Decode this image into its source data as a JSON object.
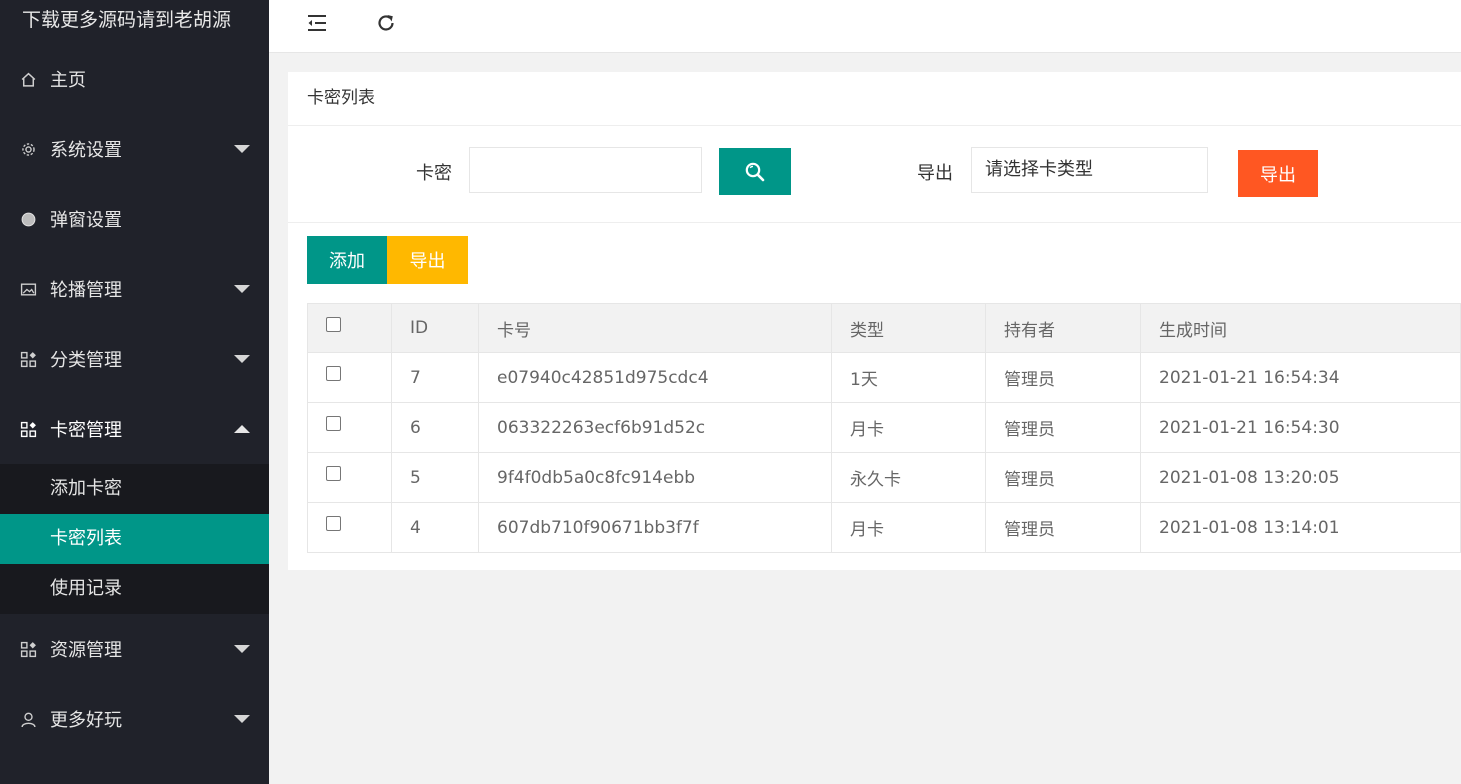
{
  "sidebar": {
    "logo": "下载更多源码请到老胡源",
    "items": [
      {
        "label": "主页"
      },
      {
        "label": "系统设置"
      },
      {
        "label": "弹窗设置"
      },
      {
        "label": "轮播管理"
      },
      {
        "label": "分类管理"
      },
      {
        "label": "卡密管理"
      },
      {
        "label": "资源管理"
      },
      {
        "label": "更多好玩"
      }
    ],
    "sub_items": [
      {
        "label": "添加卡密"
      },
      {
        "label": "卡密列表"
      },
      {
        "label": "使用记录"
      }
    ]
  },
  "header": {
    "menu_toggle_icon": "indent-icon",
    "refresh_icon": "refresh-icon"
  },
  "card": {
    "title": "卡密列表",
    "search": {
      "label": "卡密",
      "value": "",
      "button_icon": "search-icon"
    },
    "export": {
      "label": "导出",
      "select_value": "请选择卡类型",
      "button_label": "导出"
    },
    "toolbar": {
      "add_label": "添加",
      "export_label": "导出"
    },
    "table": {
      "headers": [
        "ID",
        "卡号",
        "类型",
        "持有者",
        "生成时间"
      ],
      "rows": [
        {
          "id": "7",
          "card_no": "e07940c42851d975cdc4",
          "type": "1天",
          "owner": "管理员",
          "created": "2021-01-21 16:54:34"
        },
        {
          "id": "6",
          "card_no": "063322263ecf6b91d52c",
          "type": "月卡",
          "owner": "管理员",
          "created": "2021-01-21 16:54:30"
        },
        {
          "id": "5",
          "card_no": "9f4f0db5a0c8fc914ebb",
          "type": "永久卡",
          "owner": "管理员",
          "created": "2021-01-08 13:20:05"
        },
        {
          "id": "4",
          "card_no": "607db710f90671bb3f7f",
          "type": "月卡",
          "owner": "管理员",
          "created": "2021-01-08 13:14:01"
        }
      ]
    }
  },
  "colors": {
    "sidebar_bg": "#20222a",
    "submenu_bg": "#18191e",
    "accent": "#009688",
    "danger": "#ff5722",
    "warm": "#ffb800"
  }
}
